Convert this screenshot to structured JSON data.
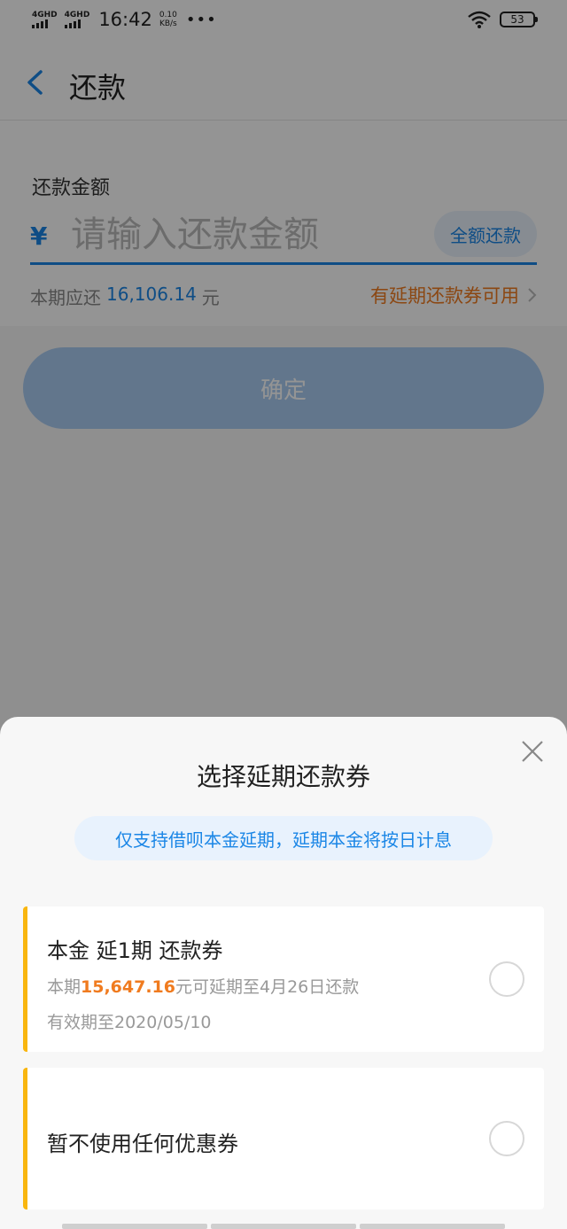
{
  "status_bar": {
    "net1": "4GHD",
    "net2": "4GHD",
    "time": "16:42",
    "speed_value": "0.10",
    "speed_unit": "KB/s",
    "more": "•••",
    "battery": "53"
  },
  "header": {
    "title": "还款"
  },
  "form": {
    "amount_label": "还款金额",
    "currency": "¥",
    "amount_placeholder": "请输入还款金额",
    "amount_value": "",
    "full_repay_label": "全额还款",
    "due_prefix": "本期应还",
    "due_amount": "16,106.14",
    "due_unit": "元",
    "coupon_available": "有延期还款券可用",
    "confirm_label": "确定"
  },
  "sheet": {
    "title": "选择延期还款券",
    "notice": "仅支持借呗本金延期，延期本金将按日计息",
    "coupons": [
      {
        "title": "本金 延1期 还款券",
        "desc_prefix": "本期",
        "desc_amount": "15,647.16",
        "desc_suffix": "元可延期至4月26日还款",
        "validity": "有效期至2020/05/10",
        "selected": false
      }
    ],
    "no_coupon_label": "暂不使用任何优惠券",
    "no_coupon_selected": false
  },
  "colors": {
    "accent": "#1a86e6",
    "orange": "#f07b1f",
    "coupon_bar": "#f9b60f",
    "confirm_disabled": "#a9ccf2"
  }
}
